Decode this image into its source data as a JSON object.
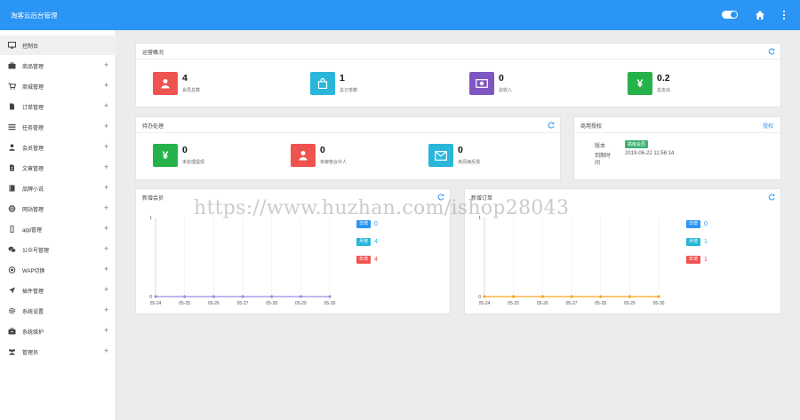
{
  "app": {
    "title": "淘客云后台管理"
  },
  "sidebar": {
    "items": [
      {
        "label": "控制台",
        "icon": "monitor-icon",
        "expandable": false,
        "active": true
      },
      {
        "label": "商品管理",
        "icon": "bag-icon",
        "expandable": true
      },
      {
        "label": "商城管理",
        "icon": "cart-icon",
        "expandable": true
      },
      {
        "label": "订单管理",
        "icon": "file-icon",
        "expandable": true
      },
      {
        "label": "任务管理",
        "icon": "list-icon",
        "expandable": true
      },
      {
        "label": "会员管理",
        "icon": "user-icon",
        "expandable": true
      },
      {
        "label": "文章管理",
        "icon": "doc-icon",
        "expandable": true
      },
      {
        "label": "品牌小说",
        "icon": "book-icon",
        "expandable": true
      },
      {
        "label": "网站管理",
        "icon": "globe-icon",
        "expandable": true
      },
      {
        "label": "app管理",
        "icon": "phone-icon",
        "expandable": true
      },
      {
        "label": "公众号管理",
        "icon": "wechat-icon",
        "expandable": true
      },
      {
        "label": "WAP切换",
        "icon": "wap-icon",
        "expandable": true
      },
      {
        "label": "插件管理",
        "icon": "rocket-icon",
        "expandable": true
      },
      {
        "label": "系统设置",
        "icon": "gear-icon",
        "expandable": true
      },
      {
        "label": "系统维护",
        "icon": "toolbox-icon",
        "expandable": true
      },
      {
        "label": "管理员",
        "icon": "group-icon",
        "expandable": true
      }
    ],
    "plus": "+"
  },
  "overview": {
    "title": "运营概况",
    "stats": [
      {
        "value": "4",
        "label": "会员总数",
        "color": "#ef5350",
        "icon": "user-icon"
      },
      {
        "value": "1",
        "label": "总订单数",
        "color": "#29b6d8",
        "icon": "shopping-bag-icon"
      },
      {
        "value": "0",
        "label": "总收入",
        "color": "#7e57c2",
        "icon": "money-icon"
      },
      {
        "value": "0.2",
        "label": "总支出",
        "color": "#26b24b",
        "icon": "yen-icon"
      }
    ]
  },
  "pending": {
    "title": "待办处理",
    "stats": [
      {
        "value": "0",
        "label": "未处理提现",
        "color": "#26b24b",
        "icon": "yen-icon"
      },
      {
        "value": "0",
        "label": "未审核合伙人",
        "color": "#ef5350",
        "icon": "user-icon"
      },
      {
        "value": "0",
        "label": "未阅读反馈",
        "color": "#29b6d8",
        "icon": "mail-icon"
      }
    ]
  },
  "license": {
    "title": "商用授权",
    "link": "授权",
    "version_label": "版本",
    "version_badge": "高级会员",
    "expire_label_1": "到期时",
    "expire_label_2": "间",
    "expire_value": "2019-06-22 11:56:14"
  },
  "new_members": {
    "title": "新增会员",
    "legend": [
      {
        "tag": "日增",
        "value": "0",
        "color": "#2b95f5"
      },
      {
        "tag": "月增",
        "value": "4",
        "color": "#29b6d8"
      },
      {
        "tag": "年增",
        "value": "4",
        "color": "#ef5350"
      }
    ]
  },
  "new_orders": {
    "title": "新增订单",
    "legend": [
      {
        "tag": "日增",
        "value": "0",
        "color": "#2b95f5"
      },
      {
        "tag": "月增",
        "value": "1",
        "color": "#29b6d8"
      },
      {
        "tag": "年增",
        "value": "1",
        "color": "#ef5350"
      }
    ]
  },
  "chart_data": [
    {
      "type": "line",
      "x": [
        "05-24",
        "05-25",
        "05-26",
        "05-27",
        "05-28",
        "05-29",
        "05-30"
      ],
      "series": [
        {
          "values": [
            0,
            0,
            0,
            0,
            0,
            0,
            0
          ],
          "color": "#9b8fe0"
        }
      ],
      "ylim": [
        0,
        1
      ],
      "yticks": [
        "0",
        "1"
      ]
    },
    {
      "type": "line",
      "x": [
        "05-24",
        "05-25",
        "05-26",
        "05-27",
        "05-28",
        "05-29",
        "05-30"
      ],
      "series": [
        {
          "values": [
            0,
            0,
            0,
            0,
            0,
            0,
            0
          ],
          "color": "#f5a623"
        }
      ],
      "ylim": [
        0,
        1
      ],
      "yticks": [
        "0",
        "1"
      ]
    }
  ],
  "watermark": "https://www.huzhan.com/ishop28043"
}
